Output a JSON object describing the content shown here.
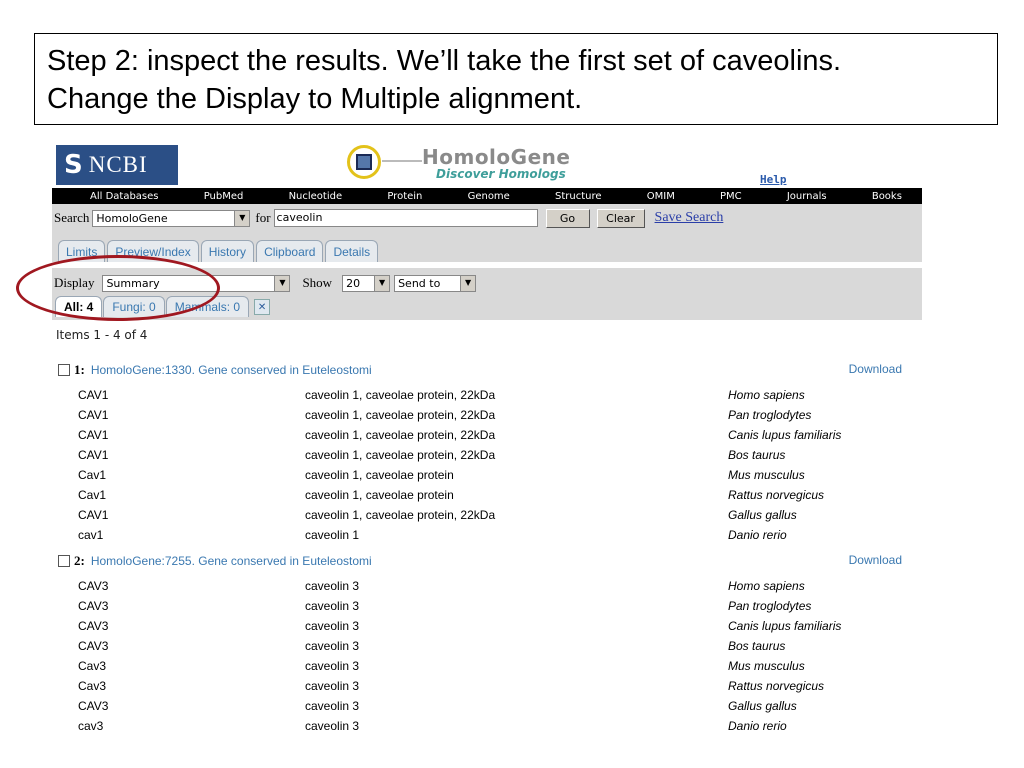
{
  "caption": {
    "line1": "Step 2: inspect the results. We’ll take the first set of caveolins.",
    "line2": "Change the Display to Multiple alignment."
  },
  "header": {
    "ncbi_logo_text": "NCBI",
    "homologene_title": "HomoloGene",
    "homologene_subtitle": "Discover Homologs",
    "help": "Help"
  },
  "nav": [
    "All Databases",
    "PubMed",
    "Nucleotide",
    "Protein",
    "Genome",
    "Structure",
    "OMIM",
    "PMC",
    "Journals",
    "Books"
  ],
  "search": {
    "label": "Search",
    "db": "HomoloGene",
    "for_label": "for",
    "query": "caveolin",
    "go": "Go",
    "clear": "Clear",
    "save_search": "Save Search"
  },
  "tabs": [
    "Limits",
    "Preview/Index",
    "History",
    "Clipboard",
    "Details"
  ],
  "display": {
    "label": "Display",
    "value": "Summary",
    "show_label": "Show",
    "show_value": "20",
    "send_to": "Send to"
  },
  "subtabs": [
    "All: 4",
    "Fungi: 0",
    "Mammals: 0"
  ],
  "items_label": "Items 1 - 4 of 4",
  "groups": [
    {
      "num": "1:",
      "link": "HomoloGene:1330. Gene conserved in Euteleostomi",
      "download": "Download",
      "rows": [
        {
          "sym": "CAV1",
          "desc": "caveolin 1, caveolae protein, 22kDa",
          "sp": "Homo sapiens"
        },
        {
          "sym": "CAV1",
          "desc": "caveolin 1, caveolae protein, 22kDa",
          "sp": "Pan troglodytes"
        },
        {
          "sym": "CAV1",
          "desc": "caveolin 1, caveolae protein, 22kDa",
          "sp": "Canis lupus familiaris"
        },
        {
          "sym": "CAV1",
          "desc": "caveolin 1, caveolae protein, 22kDa",
          "sp": "Bos taurus"
        },
        {
          "sym": "Cav1",
          "desc": "caveolin 1, caveolae protein",
          "sp": "Mus musculus"
        },
        {
          "sym": "Cav1",
          "desc": "caveolin 1, caveolae protein",
          "sp": "Rattus norvegicus"
        },
        {
          "sym": "CAV1",
          "desc": "caveolin 1, caveolae protein, 22kDa",
          "sp": "Gallus gallus"
        },
        {
          "sym": "cav1",
          "desc": "caveolin 1",
          "sp": "Danio rerio"
        }
      ]
    },
    {
      "num": "2:",
      "link": "HomoloGene:7255. Gene conserved in Euteleostomi",
      "download": "Download",
      "rows": [
        {
          "sym": "CAV3",
          "desc": "caveolin 3",
          "sp": "Homo sapiens"
        },
        {
          "sym": "CAV3",
          "desc": "caveolin 3",
          "sp": "Pan troglodytes"
        },
        {
          "sym": "CAV3",
          "desc": "caveolin 3",
          "sp": "Canis lupus familiaris"
        },
        {
          "sym": "CAV3",
          "desc": "caveolin 3",
          "sp": "Bos taurus"
        },
        {
          "sym": "Cav3",
          "desc": "caveolin 3",
          "sp": "Mus musculus"
        },
        {
          "sym": "Cav3",
          "desc": "caveolin 3",
          "sp": "Rattus norvegicus"
        },
        {
          "sym": "CAV3",
          "desc": "caveolin 3",
          "sp": "Gallus gallus"
        },
        {
          "sym": "cav3",
          "desc": "caveolin 3",
          "sp": "Danio rerio"
        }
      ]
    }
  ]
}
